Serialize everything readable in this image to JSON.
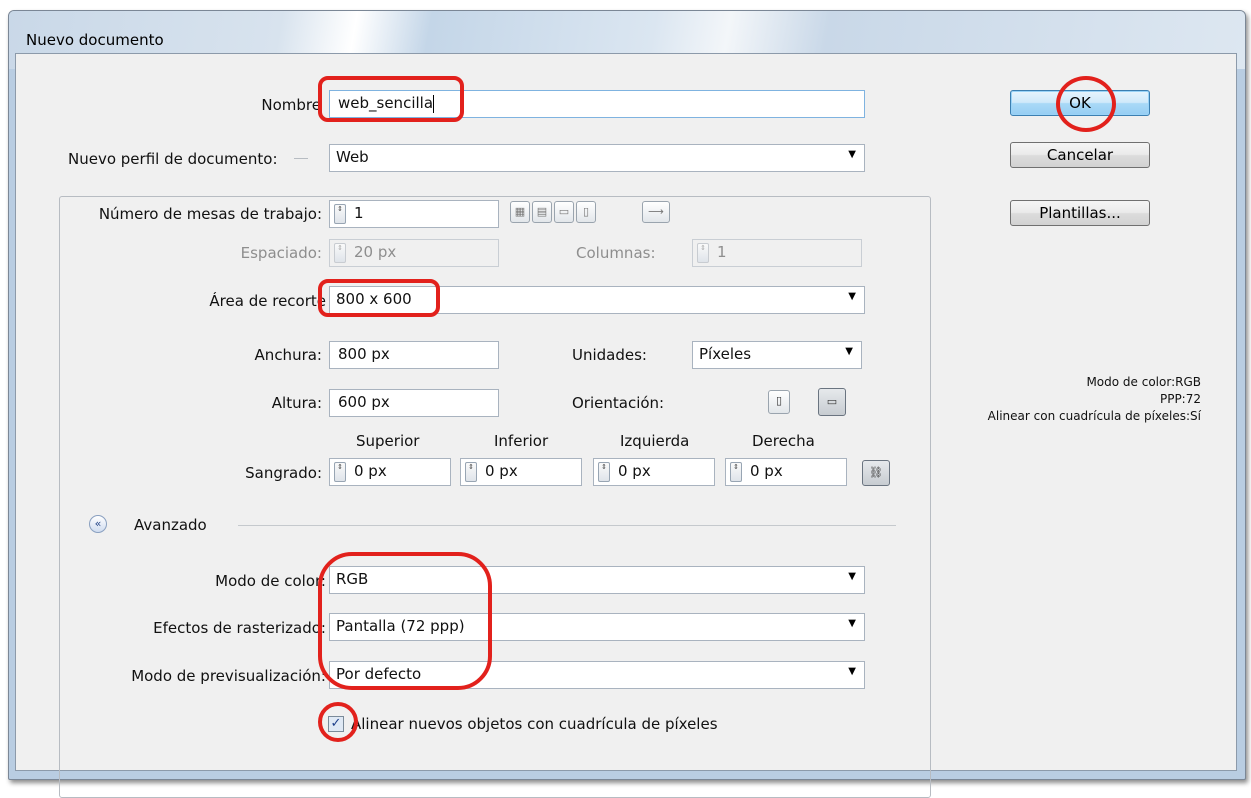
{
  "window": {
    "title": "Nuevo documento"
  },
  "buttons": {
    "ok": "OK",
    "cancel": "Cancelar",
    "templates": "Plantillas..."
  },
  "form": {
    "name_label": "Nombre",
    "name_value": "web_sencilla",
    "profile_label": "Nuevo perfil de documento:",
    "profile_value": "Web",
    "artboards_label": "Número de mesas de trabajo:",
    "artboards_value": "1",
    "spacing_label": "Espaciado:",
    "spacing_value": "20 px",
    "columns_label": "Columnas:",
    "columns_value": "1",
    "size_label": "Área de recorte",
    "size_value": "800 x 600",
    "width_label": "Anchura:",
    "width_value": "800 px",
    "units_label": "Unidades:",
    "units_value": "Píxeles",
    "height_label": "Altura:",
    "height_value": "600 px",
    "orientation_label": "Orientación:",
    "bleed_label": "Sangrado:",
    "bleed": [
      {
        "header": "Superior",
        "value": "0 px"
      },
      {
        "header": "Inferior",
        "value": "0 px"
      },
      {
        "header": "Izquierda",
        "value": "0 px"
      },
      {
        "header": "Derecha",
        "value": "0 px"
      }
    ]
  },
  "advanced": {
    "label": "Avanzado",
    "color_mode_label": "Modo de color:",
    "color_mode_value": "RGB",
    "raster_label": "Efectos de rasterizado:",
    "raster_value": "Pantalla (72 ppp)",
    "preview_label": "Modo de previsualización:",
    "preview_value": "Por defecto",
    "align_checkbox_label": "Alinear nuevos objetos con cuadrícula de píxeles",
    "align_checked": true
  },
  "info": {
    "line1": "Modo de color:RGB",
    "line2": "PPP:72",
    "line3": "Alinear con cuadrícula de píxeles:Sí"
  },
  "icons": {
    "dropdown": "▼",
    "spin": "⇕",
    "expand": "«",
    "check": "✓"
  },
  "colors": {
    "annotation": "#e2211c",
    "default_button": "#a9d9f7"
  }
}
